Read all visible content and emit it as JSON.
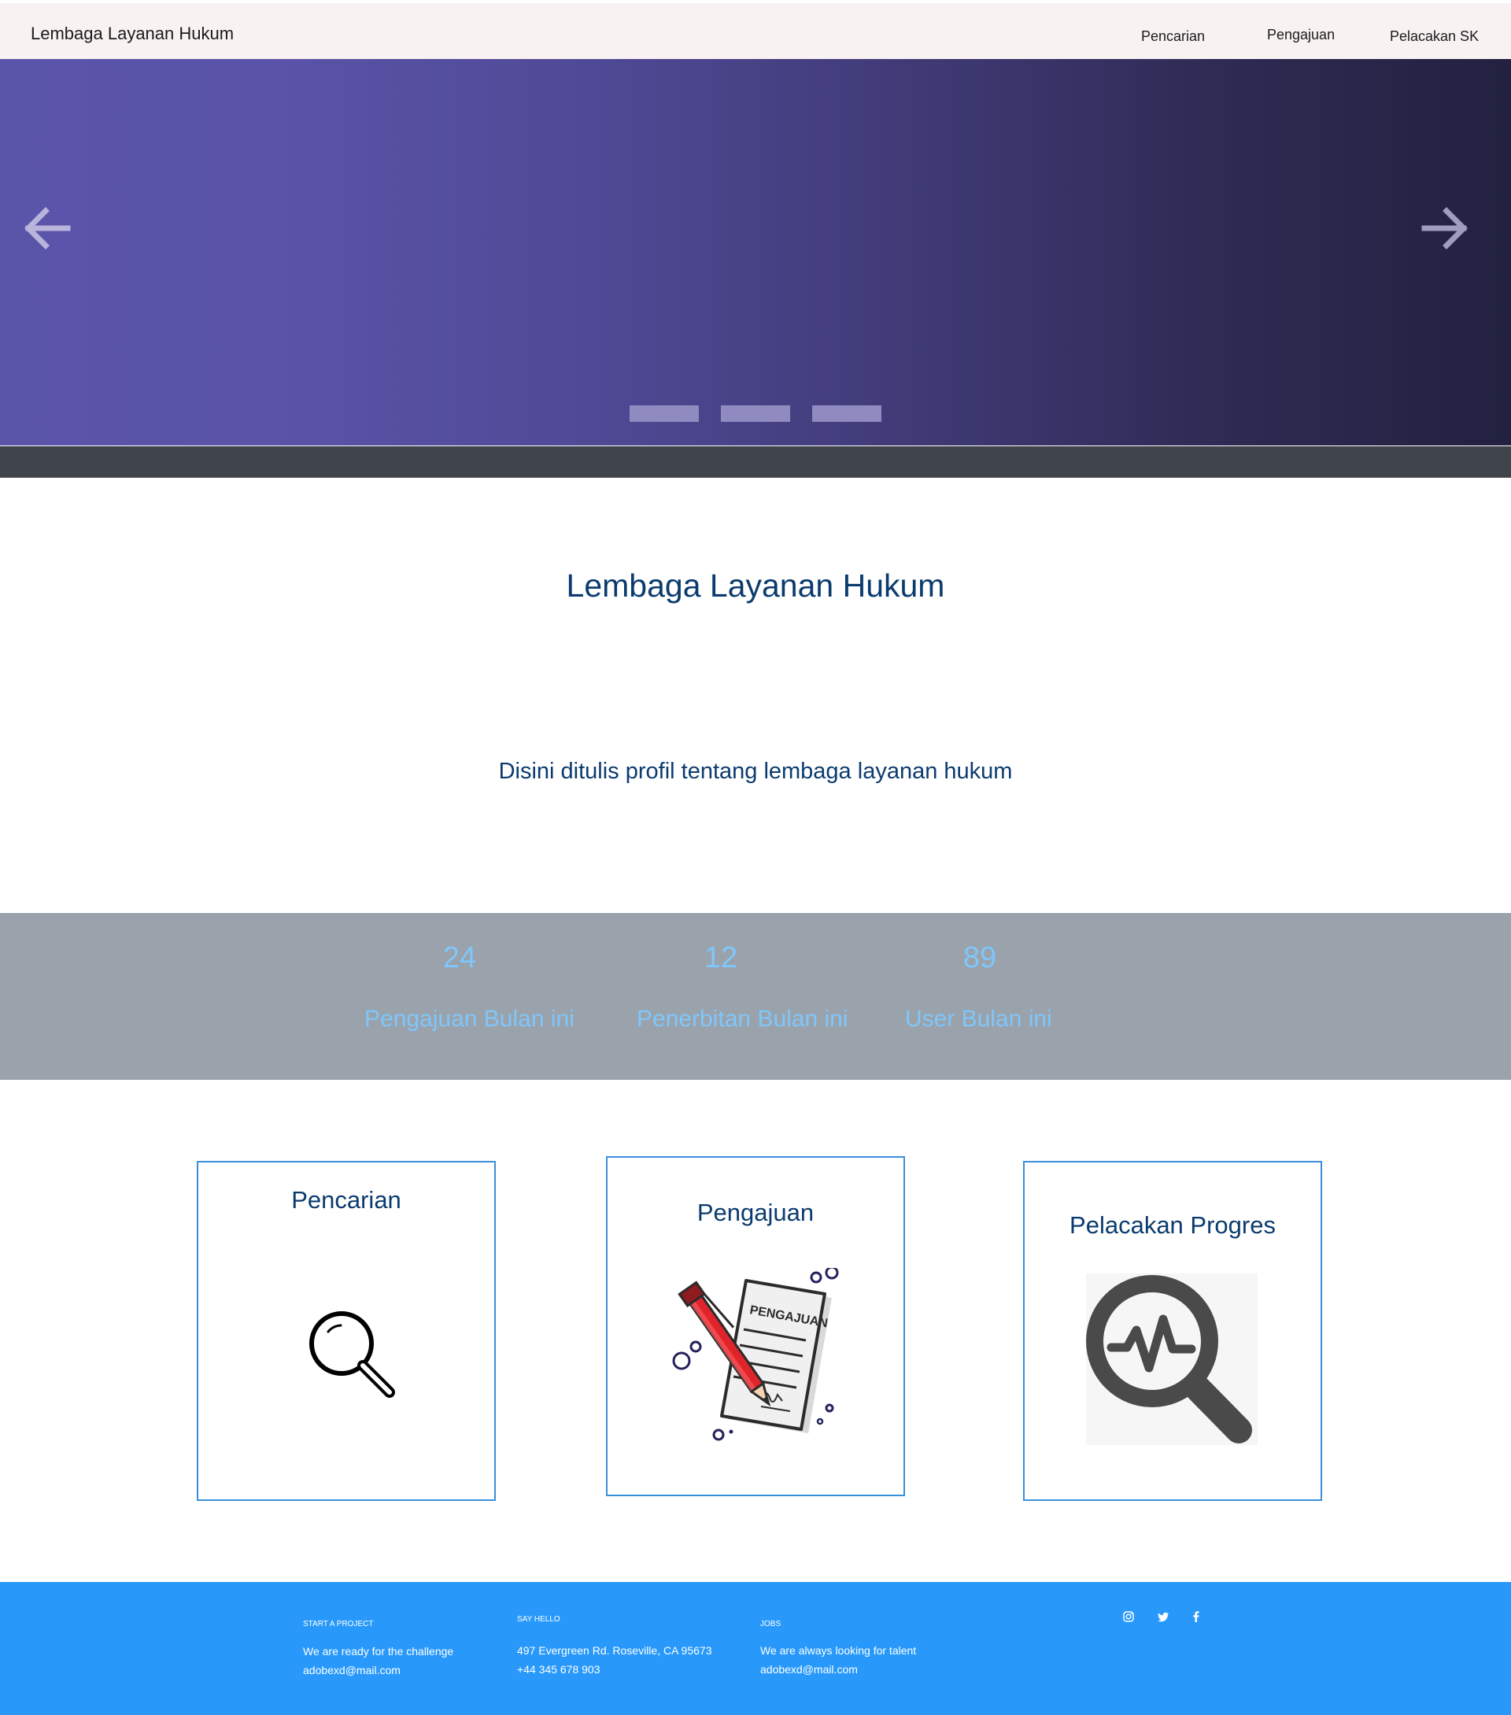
{
  "navbar": {
    "brand": "Lembaga Layanan Hukum",
    "links": [
      "Pencarian",
      "Pengajuan",
      "Pelacakan SK"
    ]
  },
  "hero": {
    "prev_icon": "arrow-left-icon",
    "next_icon": "arrow-right-icon",
    "slides": 3
  },
  "profile": {
    "title": "Lembaga Layanan Hukum",
    "description": "Disini ditulis profil tentang lembaga layanan hukum"
  },
  "stats": [
    {
      "value": "24",
      "label": "Pengajuan Bulan ini"
    },
    {
      "value": "12",
      "label": "Penerbitan Bulan ini"
    },
    {
      "value": "89",
      "label": "User Bulan ini"
    }
  ],
  "cards": [
    {
      "title": "Pencarian",
      "icon": "magnifier-icon"
    },
    {
      "title": "Pengajuan",
      "icon": "document-pen-icon",
      "doc_label": "PENGAJUAN"
    },
    {
      "title": "Pelacakan Progres",
      "icon": "progress-search-icon"
    }
  ],
  "footer": {
    "columns": [
      {
        "heading": "START A PROJECT",
        "lines": [
          "We are ready for the challenge",
          "adobexd@mail.com"
        ]
      },
      {
        "heading": "SAY HELLO",
        "lines": [
          "497 Evergreen Rd. Roseville, CA 95673",
          "+44 345 678 903"
        ]
      },
      {
        "heading": "JOBS",
        "lines": [
          "We are always looking for talent",
          "adobexd@mail.com"
        ]
      }
    ],
    "social_icons": [
      "instagram-icon",
      "twitter-icon",
      "facebook-icon"
    ]
  },
  "colors": {
    "nav_bg": "#f8f2f2",
    "title_text": "#0b3b6e",
    "stats_bg": "#9aa2ac",
    "stats_text": "#7fc7fb",
    "card_border": "#3a8fdc",
    "footer_bg": "#2899fa"
  }
}
